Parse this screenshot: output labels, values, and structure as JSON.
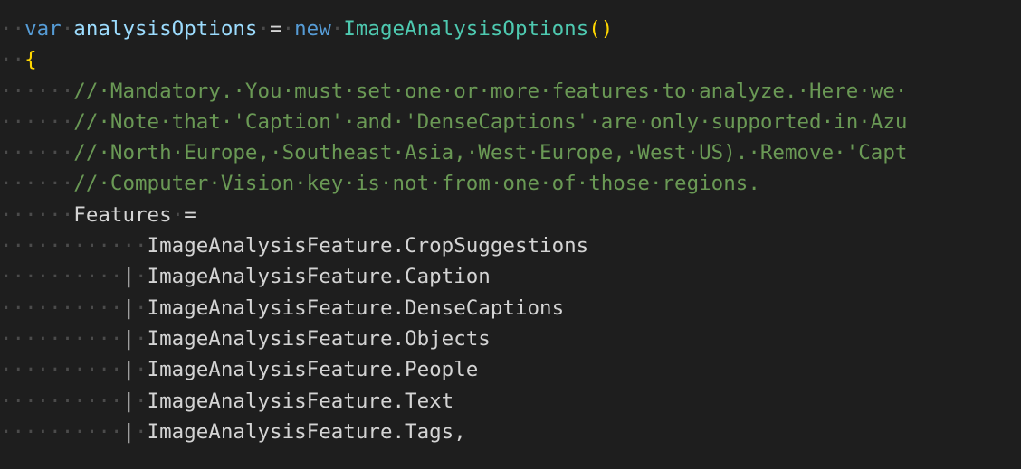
{
  "editor": {
    "colors": {
      "background": "#1e1e1e",
      "keyword": "#569cd6",
      "variable": "#9cdcfe",
      "type": "#4ec9b0",
      "comment": "#6a9955",
      "bracket": "#ffd700",
      "default": "#d4d4d4",
      "whitespace": "#4b4b4b"
    },
    "lines": [
      {
        "indent": "··",
        "tokens": [
          {
            "t": "kw",
            "v": "var"
          },
          {
            "t": "ws",
            "v": "·"
          },
          {
            "t": "var",
            "v": "analysisOptions"
          },
          {
            "t": "ws",
            "v": "·"
          },
          {
            "t": "punc",
            "v": "="
          },
          {
            "t": "ws",
            "v": "·"
          },
          {
            "t": "kw",
            "v": "new"
          },
          {
            "t": "ws",
            "v": "·"
          },
          {
            "t": "type",
            "v": "ImageAnalysisOptions"
          },
          {
            "t": "paren",
            "v": "()"
          }
        ]
      },
      {
        "indent": "··",
        "tokens": [
          {
            "t": "brace",
            "v": "{"
          }
        ]
      },
      {
        "indent": "······",
        "tokens": [
          {
            "t": "comment",
            "v": "//·Mandatory.·You·must·set·one·or·more·features·to·analyze.·Here·we·"
          }
        ]
      },
      {
        "indent": "······",
        "tokens": [
          {
            "t": "comment",
            "v": "//·Note·that·'Caption'·and·'DenseCaptions'·are·only·supported·in·Azu"
          }
        ]
      },
      {
        "indent": "······",
        "tokens": [
          {
            "t": "comment",
            "v": "//·North·Europe,·Southeast·Asia,·West·Europe,·West·US).·Remove·'Capt"
          }
        ]
      },
      {
        "indent": "······",
        "tokens": [
          {
            "t": "comment",
            "v": "//·Computer·Vision·key·is·not·from·one·of·those·regions."
          }
        ]
      },
      {
        "indent": "······",
        "tokens": [
          {
            "t": "prop",
            "v": "Features"
          },
          {
            "t": "ws",
            "v": "·"
          },
          {
            "t": "punc",
            "v": "="
          }
        ]
      },
      {
        "indent": "············",
        "tokens": [
          {
            "t": "ident",
            "v": "ImageAnalysisFeature.CropSuggestions"
          }
        ]
      },
      {
        "indent": "··········",
        "tokens": [
          {
            "t": "pipe",
            "v": "|"
          },
          {
            "t": "ws",
            "v": "·"
          },
          {
            "t": "ident",
            "v": "ImageAnalysisFeature.Caption"
          }
        ]
      },
      {
        "indent": "··········",
        "tokens": [
          {
            "t": "pipe",
            "v": "|"
          },
          {
            "t": "ws",
            "v": "·"
          },
          {
            "t": "ident",
            "v": "ImageAnalysisFeature.DenseCaptions"
          }
        ]
      },
      {
        "indent": "··········",
        "tokens": [
          {
            "t": "pipe",
            "v": "|"
          },
          {
            "t": "ws",
            "v": "·"
          },
          {
            "t": "ident",
            "v": "ImageAnalysisFeature.Objects"
          }
        ]
      },
      {
        "indent": "··········",
        "tokens": [
          {
            "t": "pipe",
            "v": "|"
          },
          {
            "t": "ws",
            "v": "·"
          },
          {
            "t": "ident",
            "v": "ImageAnalysisFeature.People"
          }
        ]
      },
      {
        "indent": "··········",
        "tokens": [
          {
            "t": "pipe",
            "v": "|"
          },
          {
            "t": "ws",
            "v": "·"
          },
          {
            "t": "ident",
            "v": "ImageAnalysisFeature.Text"
          }
        ]
      },
      {
        "indent": "··········",
        "tokens": [
          {
            "t": "pipe",
            "v": "|"
          },
          {
            "t": "ws",
            "v": "·"
          },
          {
            "t": "ident",
            "v": "ImageAnalysisFeature.Tags,"
          }
        ]
      }
    ]
  }
}
